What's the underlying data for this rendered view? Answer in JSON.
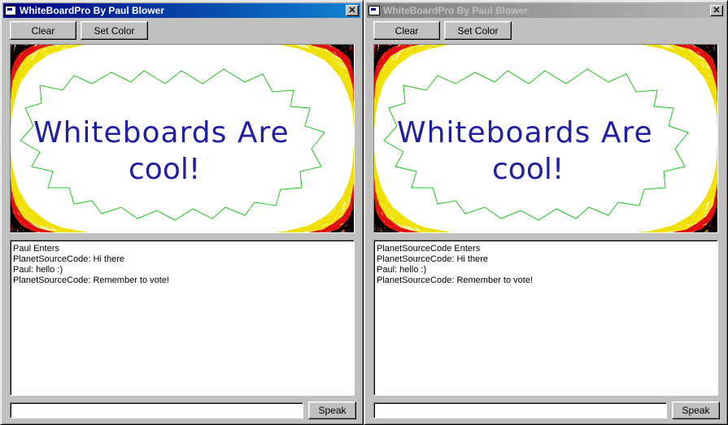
{
  "left_window": {
    "title": "WhiteBoardPro By Paul Blower",
    "close_label": "✕",
    "clear_label": "Clear",
    "set_color_label": "Set Color",
    "speak_label": "Speak",
    "input_value": "",
    "drawing_text_line1": "Whiteboards Are",
    "drawing_text_line2": "cool!",
    "chat": [
      "Paul Enters",
      "PlanetSourceCode: Hi there",
      "Paul: hello :)",
      "PlanetSourceCode: Remember to vote!"
    ]
  },
  "right_window": {
    "title": "WhiteBoardPro By Paul Blower",
    "close_label": "✕",
    "clear_label": "Clear",
    "set_color_label": "Set Color",
    "speak_label": "Speak",
    "input_value": "",
    "drawing_text_line1": "Whiteboards Are",
    "drawing_text_line2": "cool!",
    "chat": [
      "PlanetSourceCode Enters",
      "PlanetSourceCode: Hi there",
      "Paul: hello :)",
      "PlanetSourceCode: Remember to vote!"
    ]
  },
  "colors": {
    "title_active": "#000080",
    "title_inactive": "#808080",
    "scribble_black": "#000000",
    "scribble_red": "#e01010",
    "scribble_yellow": "#f0e000",
    "outline_green": "#22c322",
    "text_blue": "#2020a0"
  }
}
